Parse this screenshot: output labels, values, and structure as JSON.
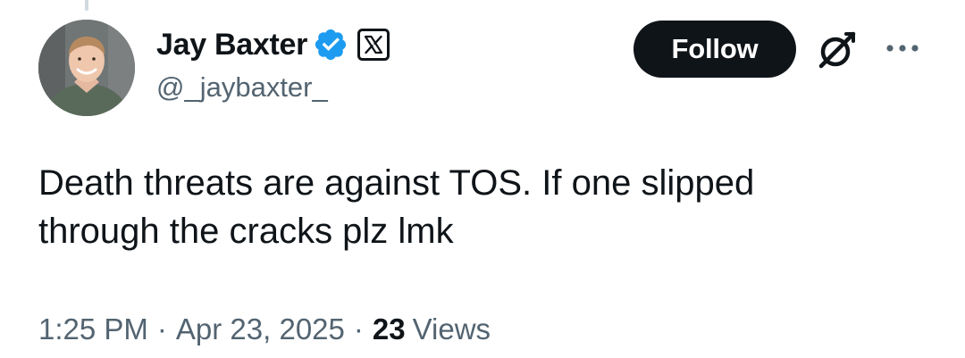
{
  "author": {
    "display_name": "Jay Baxter",
    "handle": "@_jaybaxter_",
    "verified_color": "#1d9bf0",
    "verified_icon": "verified-badge-icon",
    "affiliate_icon": "x-logo-icon"
  },
  "actions": {
    "follow_label": "Follow",
    "grok_icon": "grok-icon",
    "more_icon": "more-dots-icon"
  },
  "tweet": {
    "lines": [
      "Death threats are against TOS. If one slipped",
      "through the cracks plz lmk"
    ]
  },
  "meta": {
    "time": "1:25 PM",
    "separator": "·",
    "date": "Apr 23, 2025",
    "views_count": "23",
    "views_label": "Views"
  },
  "colors": {
    "text_primary": "#0f1419",
    "text_secondary": "#536471",
    "follow_bg": "#0f1419",
    "follow_text": "#ffffff",
    "thread_line": "#cfd9de"
  }
}
